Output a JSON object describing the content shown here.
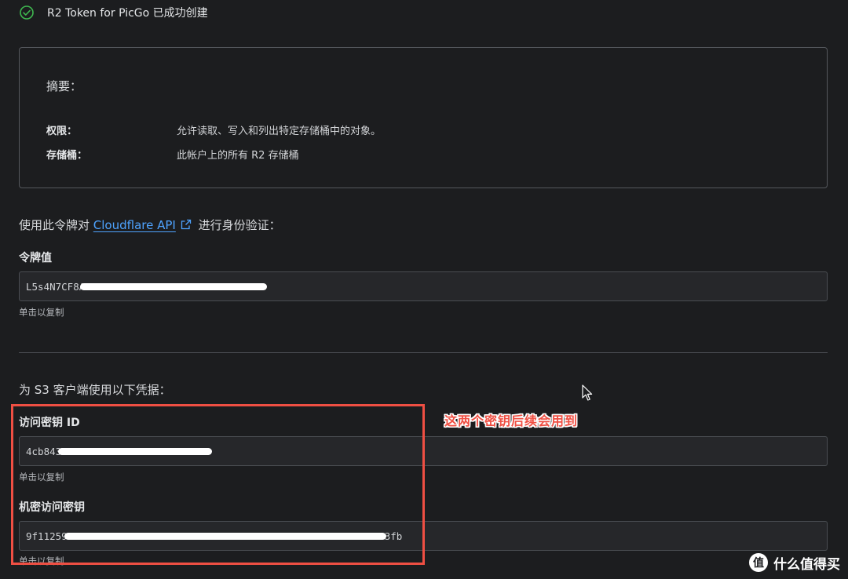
{
  "banner": {
    "message": "R2 Token for PicGo 已成功创建",
    "icon": "check-circle-icon"
  },
  "summary": {
    "heading": "摘要：",
    "rows": [
      {
        "key": "权限：",
        "value": "允许读取、写入和列出特定存储桶中的对象。"
      },
      {
        "key": "存储桶：",
        "value": "此帐户上的所有 R2 存储桶"
      }
    ]
  },
  "auth": {
    "prefix": "使用此令牌对 ",
    "link_text": "Cloudflare API",
    "suffix": " 进行身份验证："
  },
  "token": {
    "label": "令牌值",
    "value_visible": "L5s4N7CF8A",
    "hint": "单击以复制"
  },
  "s3": {
    "heading": "为 S3 客户端使用以下凭据：",
    "access_key": {
      "label": "访问密钥 ID",
      "value_visible": "4cb843",
      "hint": "单击以复制"
    },
    "secret_key": {
      "label": "机密访问密钥",
      "value_prefix": "9f11259",
      "value_suffix": "3fb",
      "hint": "单击以复制"
    }
  },
  "annotation": {
    "note": "这两个密钥后续会用到",
    "color": "#ef4f43"
  },
  "watermark": {
    "text": "什么值得买"
  },
  "colors": {
    "accent_link": "#4ea3ff",
    "success": "#3fb950",
    "background": "#1c1d1f"
  }
}
